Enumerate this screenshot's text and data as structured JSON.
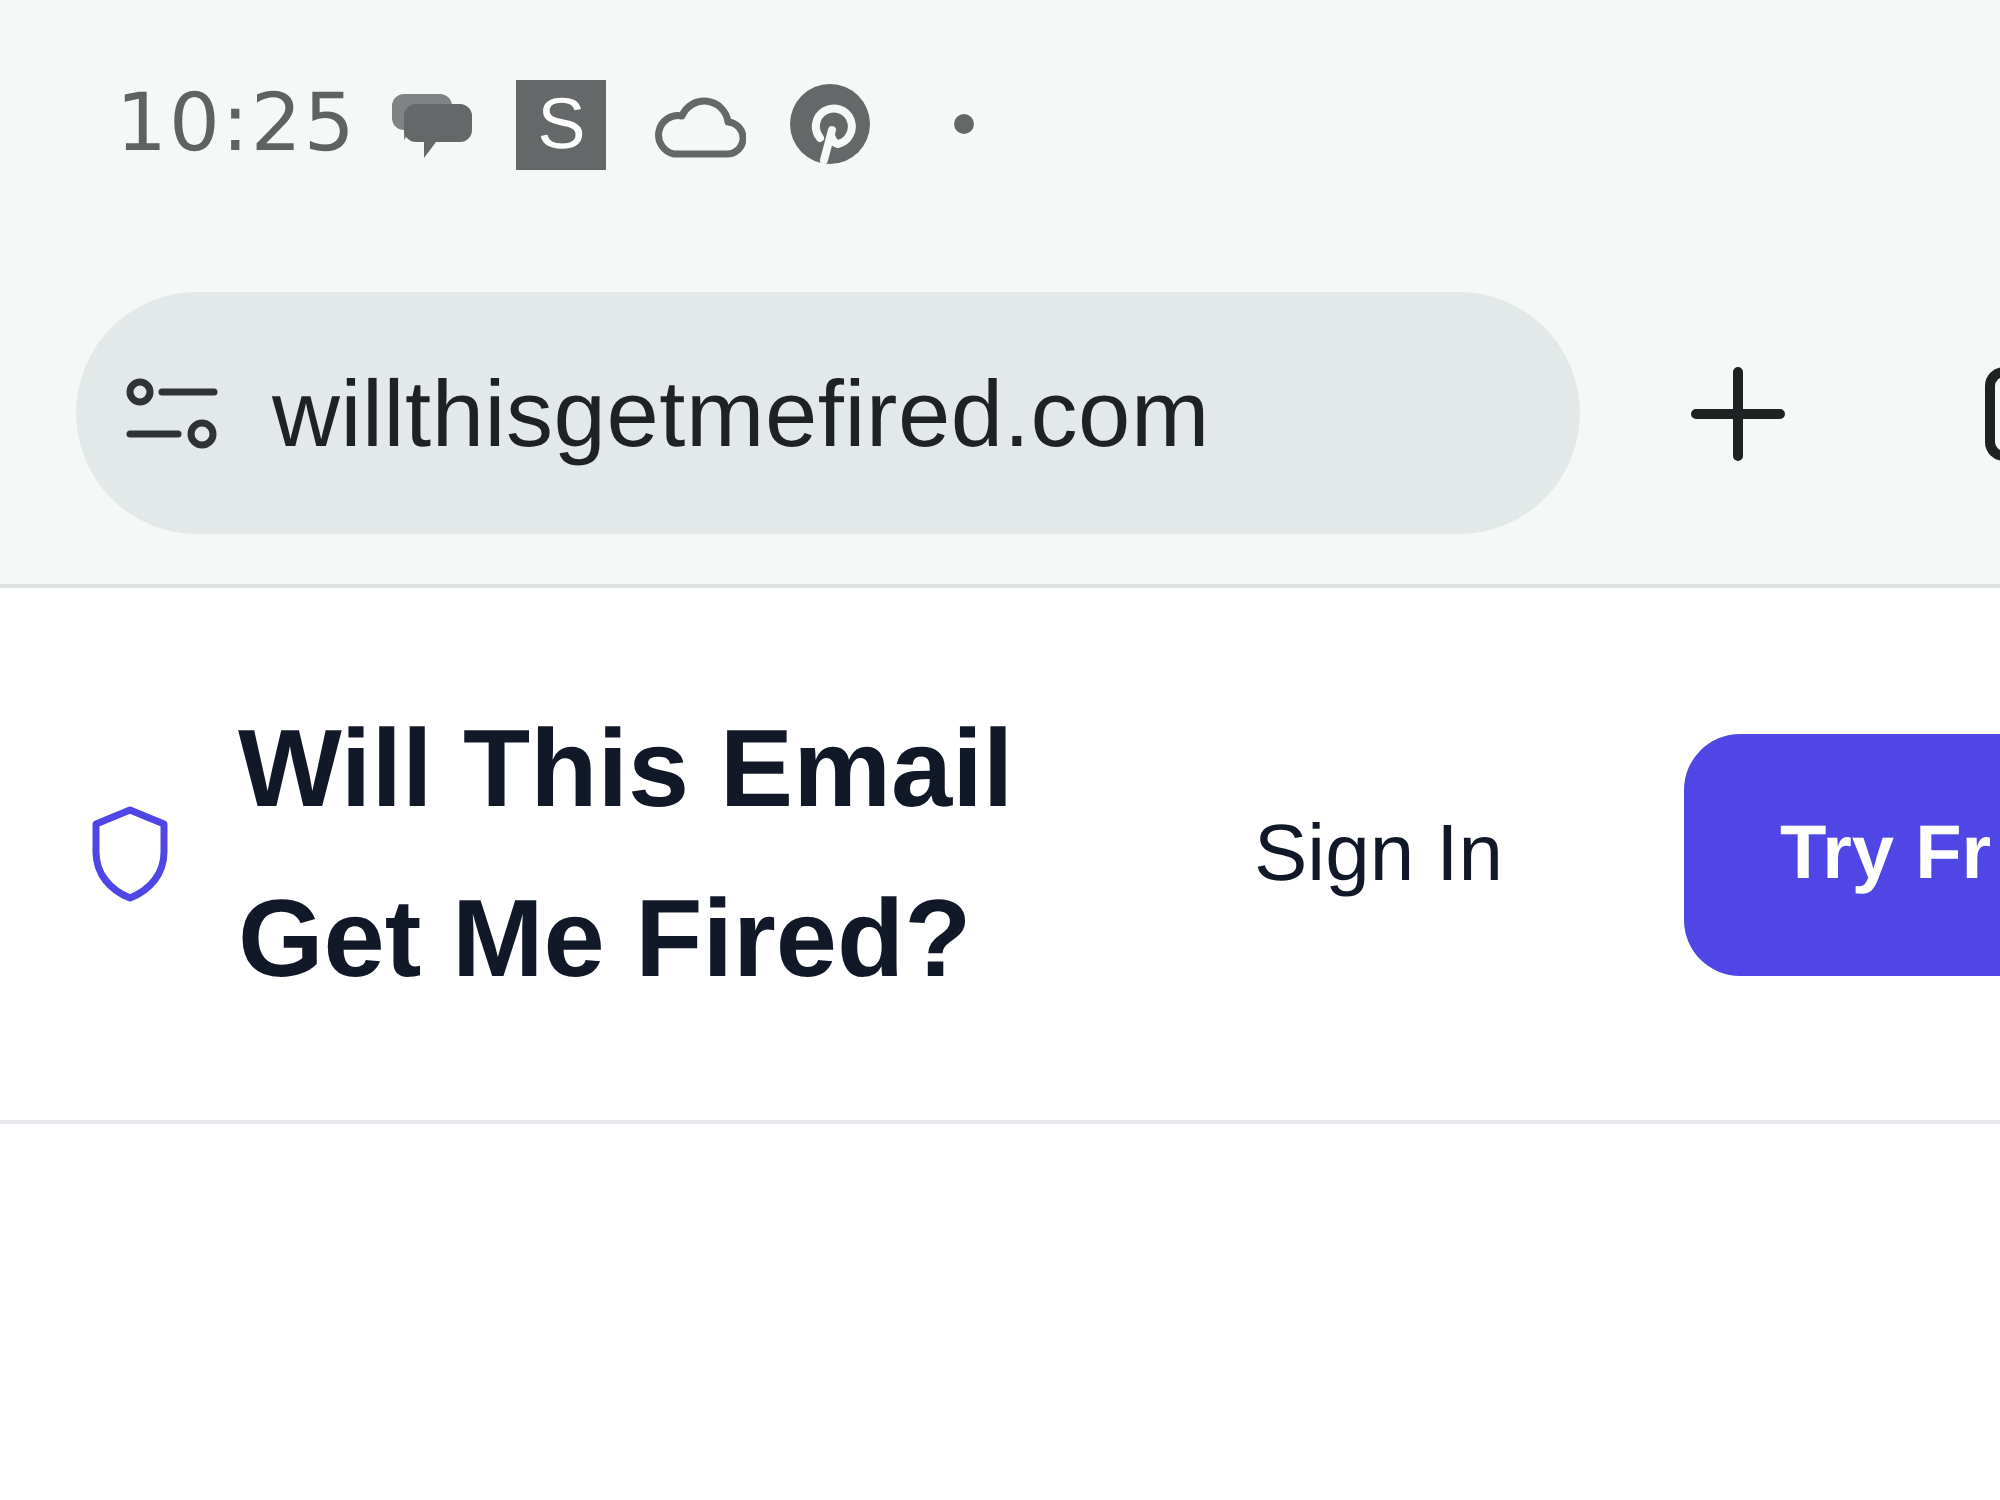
{
  "status_bar": {
    "time": "10:25",
    "notification_icons": [
      {
        "kind": "chat"
      },
      {
        "kind": "letter",
        "text": "S"
      },
      {
        "kind": "cloud"
      },
      {
        "kind": "logo"
      },
      {
        "kind": "more"
      }
    ]
  },
  "browser_toolbar": {
    "url": "willthisgetmefired.com"
  },
  "site_header": {
    "title": "Will This Email Get Me Fired?",
    "sign_in": "Sign In",
    "cta": "Try Fr"
  }
}
